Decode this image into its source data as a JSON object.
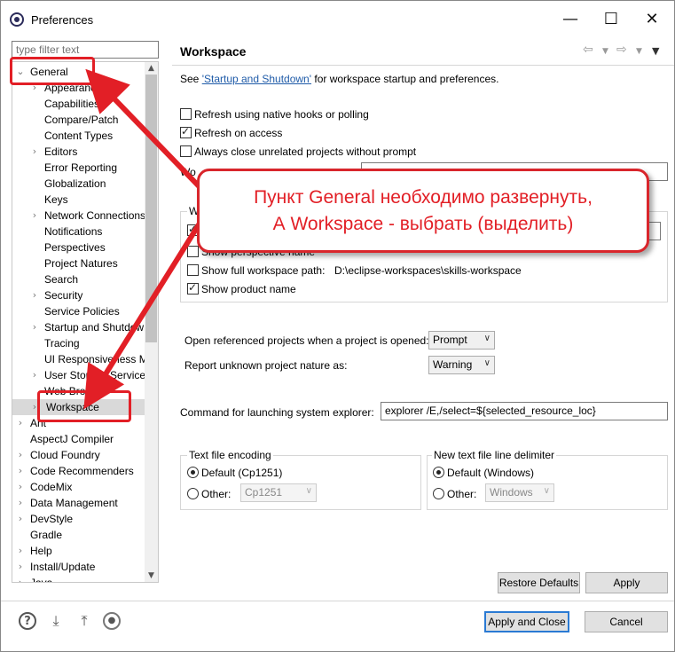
{
  "window": {
    "title": "Preferences",
    "min": "—",
    "max": "☐",
    "close": "✕"
  },
  "filter": {
    "placeholder": "type filter text"
  },
  "tree": {
    "rows": [
      {
        "label": "General",
        "level": 0,
        "twisty": "⌄"
      },
      {
        "label": "Appearance",
        "level": 1,
        "twisty": "›"
      },
      {
        "label": "Capabilities",
        "level": 1,
        "twisty": ""
      },
      {
        "label": "Compare/Patch",
        "level": 1,
        "twisty": ""
      },
      {
        "label": "Content Types",
        "level": 1,
        "twisty": ""
      },
      {
        "label": "Editors",
        "level": 1,
        "twisty": "›"
      },
      {
        "label": "Error Reporting",
        "level": 1,
        "twisty": ""
      },
      {
        "label": "Globalization",
        "level": 1,
        "twisty": ""
      },
      {
        "label": "Keys",
        "level": 1,
        "twisty": ""
      },
      {
        "label": "Network Connections",
        "level": 1,
        "twisty": "›"
      },
      {
        "label": "Notifications",
        "level": 1,
        "twisty": ""
      },
      {
        "label": "Perspectives",
        "level": 1,
        "twisty": ""
      },
      {
        "label": "Project Natures",
        "level": 1,
        "twisty": ""
      },
      {
        "label": "Search",
        "level": 1,
        "twisty": ""
      },
      {
        "label": "Security",
        "level": 1,
        "twisty": "›"
      },
      {
        "label": "Service Policies",
        "level": 1,
        "twisty": ""
      },
      {
        "label": "Startup and Shutdown",
        "level": 1,
        "twisty": "›"
      },
      {
        "label": "Tracing",
        "level": 1,
        "twisty": ""
      },
      {
        "label": "UI Responsiveness Monitoring",
        "level": 1,
        "twisty": ""
      },
      {
        "label": "User Storage Service",
        "level": 1,
        "twisty": "›"
      },
      {
        "label": "Web Browser",
        "level": 1,
        "twisty": ""
      },
      {
        "label": "Workspace",
        "level": 1,
        "twisty": "›"
      },
      {
        "label": "Ant",
        "level": 0,
        "twisty": "›"
      },
      {
        "label": "AspectJ Compiler",
        "level": 0,
        "twisty": ""
      },
      {
        "label": "Cloud Foundry",
        "level": 0,
        "twisty": "›"
      },
      {
        "label": "Code Recommenders",
        "level": 0,
        "twisty": "›"
      },
      {
        "label": "CodeMix",
        "level": 0,
        "twisty": "›"
      },
      {
        "label": "Data Management",
        "level": 0,
        "twisty": "›"
      },
      {
        "label": "DevStyle",
        "level": 0,
        "twisty": "›"
      },
      {
        "label": "Gradle",
        "level": 0,
        "twisty": ""
      },
      {
        "label": "Help",
        "level": 0,
        "twisty": "›"
      },
      {
        "label": "Install/Update",
        "level": 0,
        "twisty": "›"
      },
      {
        "label": "Java",
        "level": 0,
        "twisty": "›"
      }
    ]
  },
  "page": {
    "title": "Workspace",
    "intro_pre": "See ",
    "intro_link": "'Startup and Shutdown'",
    "intro_post": " for workspace startup and preferences.",
    "cb_refresh_native": "Refresh using native hooks or polling",
    "cb_refresh_access": "Refresh on access",
    "cb_close_unrelated": "Always close unrelated projects without prompt",
    "row_label_partial": "Wo",
    "group_label_partial": "W",
    "cb_show_perspective": "Show perspective name",
    "cb_show_full_path": "Show full workspace path:",
    "workspace_path": "D:\\eclipse-workspaces\\skills-workspace",
    "cb_show_product": "Show product name",
    "open_ref_label": "Open referenced projects when a project is opened:",
    "open_ref_value": "Prompt",
    "report_label": "Report unknown project nature as:",
    "report_value": "Warning",
    "command_label": "Command for launching system explorer:",
    "command_value": "explorer /E,/select=${selected_resource_loc}",
    "encoding_group": "Text file encoding",
    "encoding_default": "Default (Cp1251)",
    "encoding_other": "Other:",
    "encoding_other_value": "Cp1251",
    "delim_group": "New text file line delimiter",
    "delim_default": "Default (Windows)",
    "delim_other": "Other:",
    "delim_other_value": "Windows",
    "restore_defaults": "Restore Defaults",
    "apply": "Apply"
  },
  "footer": {
    "apply_close": "Apply and Close",
    "cancel": "Cancel"
  },
  "callout": {
    "line1": "Пункт General необходимо развернуть,",
    "line2": "А Workspace - выбрать (выделить)"
  },
  "colors": {
    "annotation_red": "#e21f26",
    "link": "#1f5ba8",
    "default_button_border": "#2a7ad3"
  }
}
